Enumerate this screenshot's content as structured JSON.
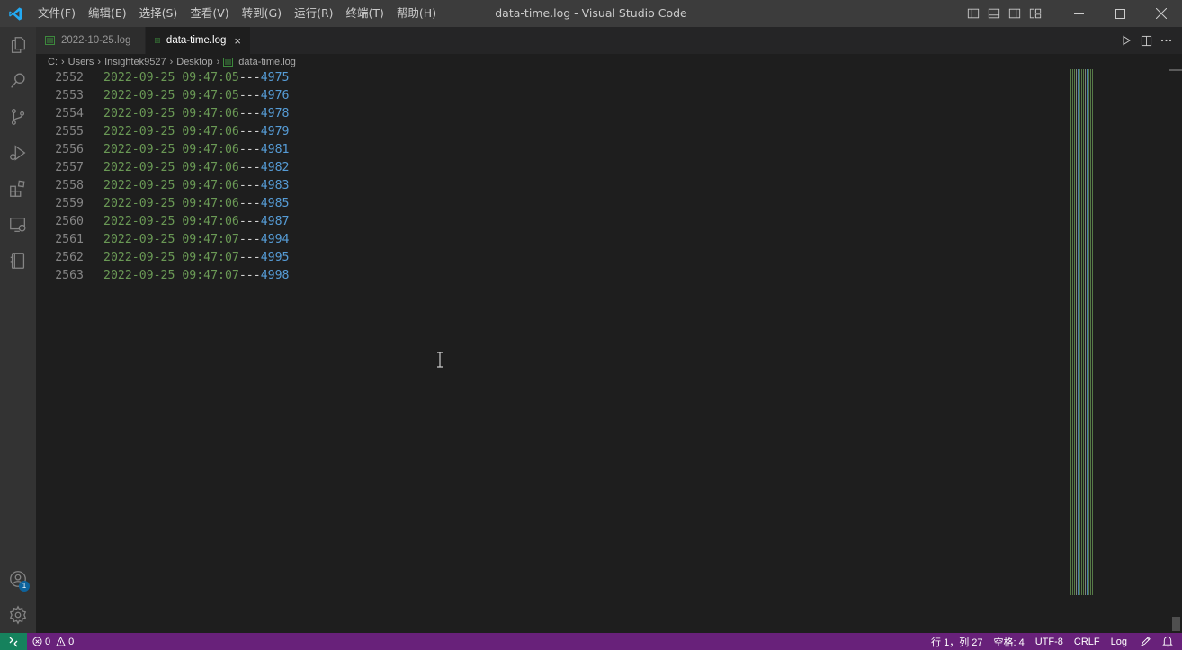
{
  "window": {
    "title": "data-time.log - Visual Studio Code"
  },
  "menu": [
    "文件(F)",
    "编辑(E)",
    "选择(S)",
    "查看(V)",
    "转到(G)",
    "运行(R)",
    "终端(T)",
    "帮助(H)"
  ],
  "activity_bar": {
    "items": [
      "explorer-icon",
      "search-icon",
      "source-control-icon",
      "run-debug-icon",
      "extensions-icon",
      "remote-explorer-icon",
      "notebook-icon"
    ],
    "account_badge": "1"
  },
  "tabs": [
    {
      "label": "2022-10-25.log",
      "active": false
    },
    {
      "label": "data-time.log",
      "active": true,
      "close": "×"
    }
  ],
  "breadcrumb": [
    "C:",
    "Users",
    "Insightek9527",
    "Desktop",
    "data-time.log"
  ],
  "editor": {
    "lines": [
      {
        "num": "2552",
        "ts": "2022-09-25 09:47:05",
        "sep": "---",
        "val": "4975"
      },
      {
        "num": "2553",
        "ts": "2022-09-25 09:47:05",
        "sep": "---",
        "val": "4976"
      },
      {
        "num": "2554",
        "ts": "2022-09-25 09:47:06",
        "sep": "---",
        "val": "4978"
      },
      {
        "num": "2555",
        "ts": "2022-09-25 09:47:06",
        "sep": "---",
        "val": "4979"
      },
      {
        "num": "2556",
        "ts": "2022-09-25 09:47:06",
        "sep": "---",
        "val": "4981"
      },
      {
        "num": "2557",
        "ts": "2022-09-25 09:47:06",
        "sep": "---",
        "val": "4982"
      },
      {
        "num": "2558",
        "ts": "2022-09-25 09:47:06",
        "sep": "---",
        "val": "4983"
      },
      {
        "num": "2559",
        "ts": "2022-09-25 09:47:06",
        "sep": "---",
        "val": "4985"
      },
      {
        "num": "2560",
        "ts": "2022-09-25 09:47:06",
        "sep": "---",
        "val": "4987"
      },
      {
        "num": "2561",
        "ts": "2022-09-25 09:47:07",
        "sep": "---",
        "val": "4994"
      },
      {
        "num": "2562",
        "ts": "2022-09-25 09:47:07",
        "sep": "---",
        "val": "4995"
      },
      {
        "num": "2563",
        "ts": "2022-09-25 09:47:07",
        "sep": "---",
        "val": "4998"
      }
    ]
  },
  "statusbar": {
    "errors": "0",
    "warnings": "0",
    "position": "行 1，列 27",
    "spaces": "空格: 4",
    "encoding": "UTF-8",
    "eol": "CRLF",
    "language": "Log"
  },
  "colors": {
    "statusbar": "#68217a",
    "timestamp": "#6a9955",
    "number": "#569cd6",
    "accent": "#007acc"
  }
}
